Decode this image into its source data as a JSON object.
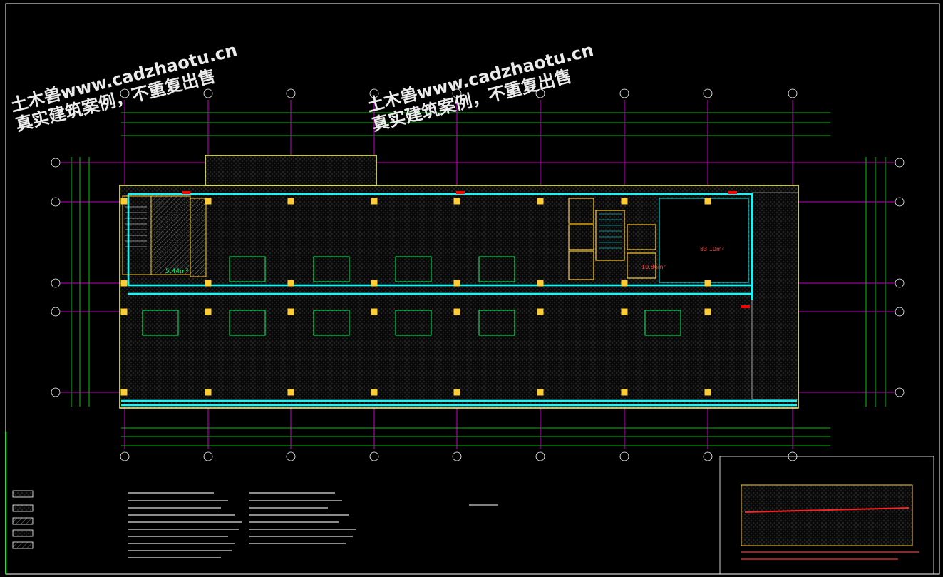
{
  "drawing": {
    "watermark": {
      "line1": "土木兽www.cadzhaotu.cn",
      "line2": "真实建筑案例，不重复出售"
    },
    "area_label": "5.44m²",
    "room_area_right": "83.10m²",
    "room_area_small": "10.86m²",
    "colors": {
      "background": "#000000",
      "frame": "#ffffff",
      "axis_line": "#ff00ff",
      "wall_cyan": "#00ffff",
      "dimension_green": "#00ff00",
      "column_yellow": "#ffcc33",
      "outline_yellow": "#ffff00",
      "annotation_red": "#ff0000"
    }
  }
}
